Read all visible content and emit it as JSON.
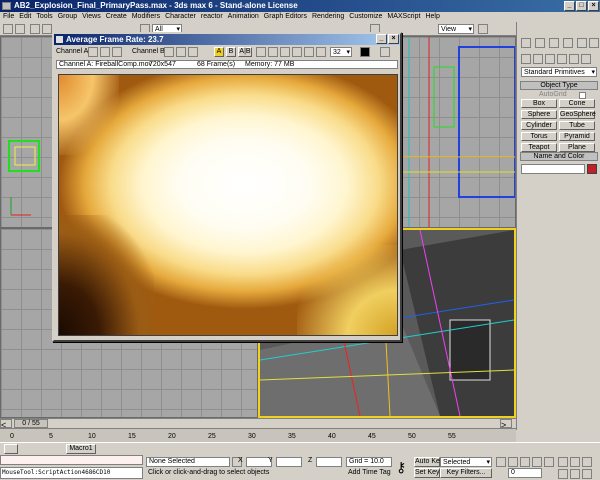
{
  "window": {
    "title": "AB2_Explosion_Final_PrimaryPass.max - 3ds max 6 - Stand-alone License"
  },
  "menu": [
    "File",
    "Edit",
    "Tools",
    "Group",
    "Views",
    "Create",
    "Modifiers",
    "Character",
    "reactor",
    "Animation",
    "Graph Editors",
    "Rendering",
    "Customize",
    "MAXScript",
    "Help"
  ],
  "toolbar": {
    "selection_filter": "All",
    "ref_coord": "View",
    "named_sel": ""
  },
  "ram_player": {
    "title": "Average Frame Rate: 23.7",
    "channel_a_label": "Channel A:",
    "channel_b_label": "Channel B:",
    "frame_field": "32",
    "info": {
      "file": "Channel A: FireballComp.mov",
      "resolution": "720x547",
      "frames": "68 Frame(s)",
      "memory": "Memory: 77 MB"
    },
    "ab_buttons": [
      "A",
      "B",
      "A|B"
    ]
  },
  "command_panel": {
    "category": "Standard Primitives",
    "object_type_title": "Object Type",
    "autogrid": "AutoGrid",
    "buttons": [
      "Box",
      "Cone",
      "Sphere",
      "GeoSphere",
      "Cylinder",
      "Tube",
      "Torus",
      "Pyramid",
      "Teapot",
      "Plane"
    ],
    "name_color_title": "Name and Color"
  },
  "timeline": {
    "position": "0 / 55",
    "ticks": [
      "0",
      "5",
      "10",
      "15",
      "20",
      "25",
      "30",
      "35",
      "40",
      "45",
      "50",
      "55"
    ]
  },
  "status": {
    "macro": "Macro1",
    "script": "MouseTool:ScriptAction4686CD10",
    "selection": "None Selected",
    "prompt": "Click or click-and-drag to select objects",
    "x_label": "X",
    "y_label": "Y",
    "z_label": "Z",
    "grid": "Grid = 10.0",
    "add_time_tag": "Add Time Tag",
    "auto_key": "Auto Key",
    "selected": "Selected",
    "set_key": "Set Key",
    "key_filters": "Key Filters...",
    "frame": "0"
  }
}
